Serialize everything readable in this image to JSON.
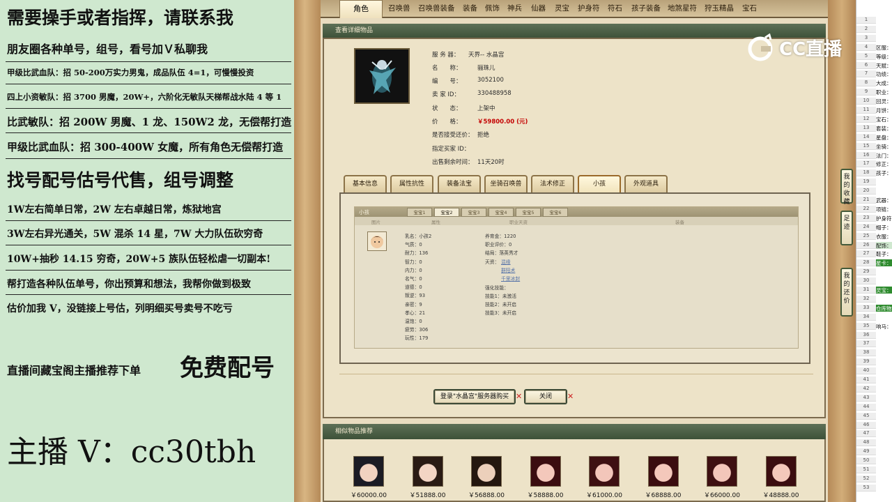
{
  "overlay": {
    "lines": [
      "需要操手或者指挥，请联系我",
      "朋友圈各种单号，组号，看号加Ｖ私聊我",
      "甲级比武血队：招 50-200万实力男鬼，成品队伍 4=1，可慢慢投资",
      "四上小资敏队：招 3700 男魔，20W+，六阶化无敏队天梯帮战水陆 4 等 1",
      "比武敏队：招 200W 男魔、1 龙、150W2 龙，无偿帮打造",
      "甲级比武血队：招 300-400W 女魔，所有角色无偿帮打造",
      "找号配号估号代售，组号调整",
      "1W左右简单日常，2W 左右卓越日常，炼狱地宫",
      "3W左右异光通关，5W 混杀 14 星，7W 大力队伍砍穷奇",
      "10W+抽秒 14.15 穷奇，20W+5 族队伍轻松虐一切副本!",
      "帮打造各种队伍单号，你出预算和想法，我帮你做到极致",
      "估价加我 V，没链接上号估，列明细买号卖号不吃亏",
      "直播间藏宝阁主播推荐下单",
      "免费配号",
      "主播 V：cc30tbh"
    ]
  },
  "top_tabs": [
    "角色",
    "召唤兽",
    "召唤兽装备",
    "装备",
    "佩饰",
    "神兵",
    "仙器",
    "灵宝",
    "护身符",
    "符石",
    "孩子装备",
    "地煞星符",
    "狩玉精晶",
    "宝石"
  ],
  "detail": {
    "section_title": "查看详细物品",
    "labels": {
      "server": "服 务 器：",
      "name": "名　　称：",
      "number": "编　　号：",
      "seller": "卖 家 ID：",
      "status": "状　　态：",
      "price": "价　　格：",
      "bargain": "是否接受还价：",
      "buyer": "指定买家 ID：",
      "time": "出售剩余时间："
    },
    "values": {
      "server": "天界-- 水晶宫",
      "name": "骊珠儿",
      "number": "3052100",
      "seller": "330488958",
      "status": "上架中",
      "price": "￥59800.00 (元)",
      "bargain": "拒绝",
      "buyer": "",
      "time": "11天20时"
    }
  },
  "bottom_tabs": [
    "基本信息",
    "属性抗性",
    "装备法宝",
    "坐骑召唤兽",
    "法术修正",
    "小孩",
    "外观道具"
  ],
  "kid_panel": {
    "title": "小孩",
    "tabs": [
      "宝宝1",
      "宝宝2",
      "宝宝3",
      "宝宝4",
      "宝宝5",
      "宝宝6"
    ],
    "columns": [
      "图片",
      "属性",
      "职业天资",
      "装备"
    ],
    "left_fields": [
      "乳名：小孩2",
      "气质：0",
      "耐力：136",
      "智力：0",
      "内力：0",
      "名气：0",
      "道德：0",
      "叛逆：93",
      "亲密：9",
      "孝心：21",
      "温饱：0",
      "疲劳：306",
      "玩性：179"
    ],
    "right_fields": [
      "养育金：1220",
      "职业评价：0",
      "结局：落英秀才",
      "天资：",
      "强化技能：",
      "技能1：未激活",
      "技能2：未开启",
      "技能3：未开启"
    ],
    "talents": [
      "混缘",
      "群阳术",
      "千里冰封"
    ]
  },
  "actions": {
    "buy": "登录\"水晶宫\"服务器购买",
    "close": "关闭"
  },
  "recommend": {
    "title": "相似物品推荐",
    "prices": [
      "￥60000.00",
      "￥51888.00",
      "￥56888.00",
      "￥58888.00",
      "￥61000.00",
      "￥68888.00",
      "￥66000.00",
      "￥48888.00"
    ]
  },
  "side_buttons": {
    "favorites": [
      "我",
      "的",
      "收",
      "藏"
    ],
    "footprint": [
      "足",
      "迹"
    ],
    "counter": [
      "我",
      "的",
      "还",
      "价"
    ]
  },
  "sheet": {
    "rows": [
      "1",
      "2",
      "3",
      "4",
      "5",
      "6",
      "7",
      "8",
      "9",
      "10",
      "11",
      "12",
      "13",
      "14",
      "15",
      "16",
      "17",
      "18",
      "19",
      "20",
      "21",
      "22",
      "23",
      "24",
      "25",
      "26",
      "27",
      "28",
      "29",
      "30",
      "31",
      "32",
      "33",
      "34",
      "35",
      "36",
      "37",
      "38",
      "39",
      "40",
      "41",
      "42",
      "43",
      "44",
      "45",
      "46",
      "47",
      "48",
      "49",
      "50",
      "51",
      "52",
      "53"
    ],
    "cells": {
      "4": "区服：",
      "5": "等级：",
      "6": "天赋：",
      "7": "功绩：",
      "8": "大成：",
      "9": "职业：",
      "10": "回灵：",
      "11": "月饼：",
      "12": "宝石：",
      "13": "套装：",
      "14": "星盘：",
      "15": "坐骑：",
      "16": "法门：",
      "17": "修正：",
      "18": "孩子：",
      "21": "武器：",
      "22": "项链：",
      "23": "护身符",
      "24": "帽子：",
      "25": "衣服：",
      "26": "配饰：",
      "27": "鞋子：",
      "28": "星卡：",
      "31": "灵宝：",
      "33": "仓库物",
      "35": "响马："
    }
  },
  "watermark": {
    "text": "CC直播"
  }
}
